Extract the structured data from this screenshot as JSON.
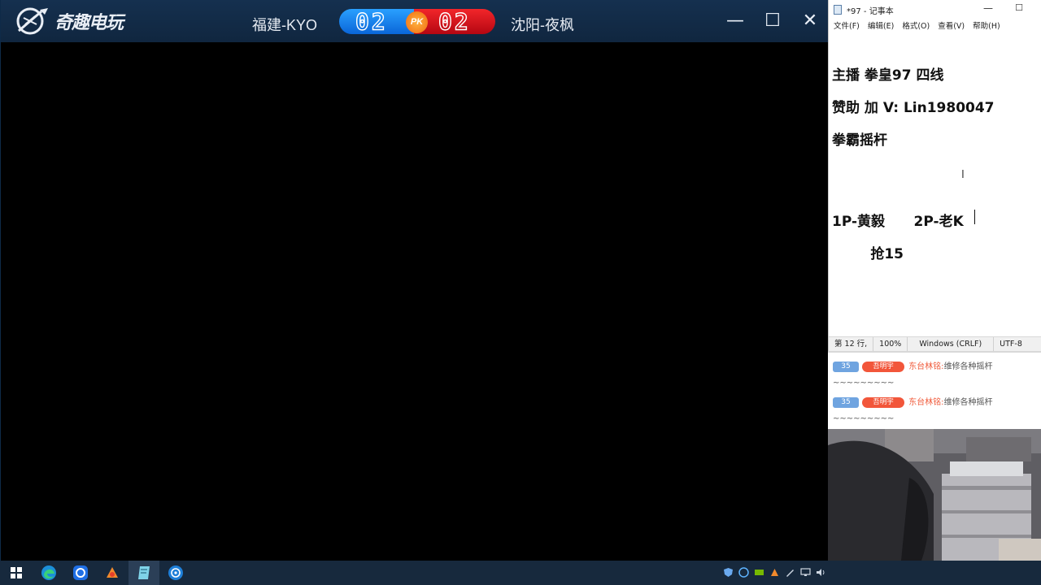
{
  "game_window": {
    "logo_text": "奇趣电玩",
    "team_left": "福建-KYO",
    "team_right": "沈阳-夜枫",
    "score_left": "02",
    "score_right": "02",
    "pk_label": "PK",
    "controls": {
      "minimize": "—",
      "maximize": "☐",
      "close": "✕"
    }
  },
  "notepad": {
    "title": "*97 - 记事本",
    "controls": {
      "minimize": "—",
      "maximize": "☐"
    },
    "menu": [
      "文件(F)",
      "编辑(E)",
      "格式(O)",
      "查看(V)",
      "帮助(H)"
    ],
    "lines": [
      "主播 拳皇97 四线",
      "赞助 加 V: Lin1980047",
      "拳霸摇杆",
      "1P-黄毅      2P-老K",
      "        抢15"
    ],
    "status": {
      "position": "第 12 行,",
      "zoom": "100%",
      "line_ending": "Windows (CRLF)",
      "encoding": "UTF-8"
    }
  },
  "chat": {
    "messages": [
      {
        "level": "35",
        "fan_badge": "吾明宇",
        "user": "东台林铭:",
        "text": "维修各种摇杆~~~~~~~~~"
      },
      {
        "level": "35",
        "fan_badge": "吾明宇",
        "user": "东台林铭:",
        "text": "维修各种摇杆~~~~~~~~~"
      }
    ]
  },
  "taskbar": {
    "apps": [
      "windows-start-icon",
      "edge-browser-icon",
      "chat-app-icon",
      "paint-app-icon",
      "notepad-app-icon",
      "game-app-icon"
    ],
    "tray": [
      "shield-icon",
      "network-app-icon",
      "nvidia-icon",
      "app-tray-icon",
      "pen-icon",
      "network-icon",
      "volume-icon"
    ]
  },
  "colors": {
    "titlebar": "#15304f",
    "score_blue": "#1a86f0",
    "score_red": "#d9121c",
    "pk_orange": "#f58a1f",
    "taskbar": "#17293d"
  }
}
